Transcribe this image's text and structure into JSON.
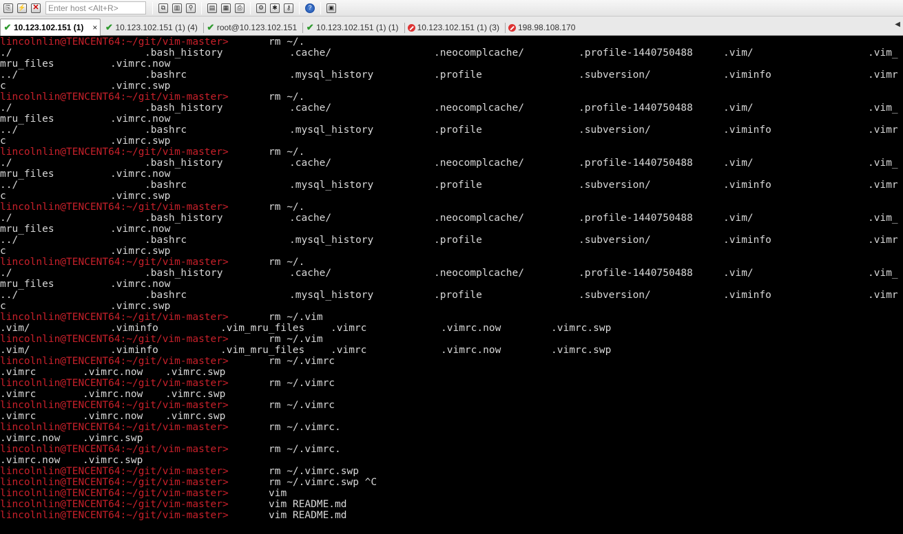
{
  "toolbar": {
    "host_placeholder": "Enter host <Alt+R>",
    "buttons": [
      {
        "name": "connect-icon",
        "glyph": "⎘"
      },
      {
        "name": "quick-connect-icon",
        "glyph": "⚡"
      },
      {
        "name": "disconnect-icon",
        "glyph": "✕"
      },
      {
        "name": "copy-icon",
        "glyph": "⧉"
      },
      {
        "name": "paste-icon",
        "glyph": "📋"
      },
      {
        "name": "find-icon",
        "glyph": "🔍"
      },
      {
        "name": "print-setup-icon",
        "glyph": "▤"
      },
      {
        "name": "print-icon",
        "glyph": "▦"
      },
      {
        "name": "printer-icon",
        "glyph": "⎙"
      },
      {
        "name": "session-options-icon",
        "glyph": "⚙"
      },
      {
        "name": "global-options-icon",
        "glyph": "✱"
      },
      {
        "name": "key-icon",
        "glyph": "⚷"
      },
      {
        "name": "help-icon",
        "glyph": "?"
      },
      {
        "name": "keymap-icon",
        "glyph": "▣"
      }
    ]
  },
  "tabs": [
    {
      "label": "10.123.102.151 (1)",
      "status": "connected",
      "active": true
    },
    {
      "label": "10.123.102.151 (1) (4)",
      "status": "connected",
      "active": false
    },
    {
      "label": "root@10.123.102.151",
      "status": "connected",
      "active": false
    },
    {
      "label": "10.123.102.151 (1) (1)",
      "status": "connected",
      "active": false
    },
    {
      "label": "10.123.102.151 (1) (3)",
      "status": "disconnected",
      "active": false
    },
    {
      "label": "198.98.108.170",
      "status": "disconnected",
      "active": false
    }
  ],
  "tab_close_glyph": "×",
  "tab_scroll_glyph": "◀",
  "terminal": {
    "prompt": "lincolnlin@TENCENT64:~/git/vim-master>",
    "lines": [
      {
        "type": "prompt",
        "cmd": "rm ~/."
      },
      {
        "type": "out",
        "cells": [
          [
            0,
            "./"
          ],
          [
            210,
            ".bash_history"
          ],
          [
            420,
            ".cache/"
          ],
          [
            630,
            ".neocomplcache/"
          ],
          [
            840,
            ".profile-1440750488"
          ],
          [
            1050,
            ".vim/"
          ],
          [
            1260,
            ".vim_"
          ]
        ]
      },
      {
        "type": "out",
        "cells": [
          [
            0,
            "mru_files"
          ],
          [
            160,
            ".vimrc.now"
          ]
        ]
      },
      {
        "type": "out",
        "cells": [
          [
            0,
            "../"
          ],
          [
            210,
            ".bashrc"
          ],
          [
            420,
            ".mysql_history"
          ],
          [
            630,
            ".profile"
          ],
          [
            840,
            ".subversion/"
          ],
          [
            1050,
            ".viminfo"
          ],
          [
            1260,
            ".vimr"
          ]
        ]
      },
      {
        "type": "out",
        "cells": [
          [
            0,
            "c"
          ],
          [
            160,
            ".vimrc.swp"
          ]
        ]
      },
      {
        "type": "prompt",
        "cmd": "rm ~/."
      },
      {
        "type": "out",
        "cells": [
          [
            0,
            "./"
          ],
          [
            210,
            ".bash_history"
          ],
          [
            420,
            ".cache/"
          ],
          [
            630,
            ".neocomplcache/"
          ],
          [
            840,
            ".profile-1440750488"
          ],
          [
            1050,
            ".vim/"
          ],
          [
            1260,
            ".vim_"
          ]
        ]
      },
      {
        "type": "out",
        "cells": [
          [
            0,
            "mru_files"
          ],
          [
            160,
            ".vimrc.now"
          ]
        ]
      },
      {
        "type": "out",
        "cells": [
          [
            0,
            "../"
          ],
          [
            210,
            ".bashrc"
          ],
          [
            420,
            ".mysql_history"
          ],
          [
            630,
            ".profile"
          ],
          [
            840,
            ".subversion/"
          ],
          [
            1050,
            ".viminfo"
          ],
          [
            1260,
            ".vimr"
          ]
        ]
      },
      {
        "type": "out",
        "cells": [
          [
            0,
            "c"
          ],
          [
            160,
            ".vimrc.swp"
          ]
        ]
      },
      {
        "type": "prompt",
        "cmd": "rm ~/."
      },
      {
        "type": "out",
        "cells": [
          [
            0,
            "./"
          ],
          [
            210,
            ".bash_history"
          ],
          [
            420,
            ".cache/"
          ],
          [
            630,
            ".neocomplcache/"
          ],
          [
            840,
            ".profile-1440750488"
          ],
          [
            1050,
            ".vim/"
          ],
          [
            1260,
            ".vim_"
          ]
        ]
      },
      {
        "type": "out",
        "cells": [
          [
            0,
            "mru_files"
          ],
          [
            160,
            ".vimrc.now"
          ]
        ]
      },
      {
        "type": "out",
        "cells": [
          [
            0,
            "../"
          ],
          [
            210,
            ".bashrc"
          ],
          [
            420,
            ".mysql_history"
          ],
          [
            630,
            ".profile"
          ],
          [
            840,
            ".subversion/"
          ],
          [
            1050,
            ".viminfo"
          ],
          [
            1260,
            ".vimr"
          ]
        ]
      },
      {
        "type": "out",
        "cells": [
          [
            0,
            "c"
          ],
          [
            160,
            ".vimrc.swp"
          ]
        ]
      },
      {
        "type": "prompt",
        "cmd": "rm ~/."
      },
      {
        "type": "out",
        "cells": [
          [
            0,
            "./"
          ],
          [
            210,
            ".bash_history"
          ],
          [
            420,
            ".cache/"
          ],
          [
            630,
            ".neocomplcache/"
          ],
          [
            840,
            ".profile-1440750488"
          ],
          [
            1050,
            ".vim/"
          ],
          [
            1260,
            ".vim_"
          ]
        ]
      },
      {
        "type": "out",
        "cells": [
          [
            0,
            "mru_files"
          ],
          [
            160,
            ".vimrc.now"
          ]
        ]
      },
      {
        "type": "out",
        "cells": [
          [
            0,
            "../"
          ],
          [
            210,
            ".bashrc"
          ],
          [
            420,
            ".mysql_history"
          ],
          [
            630,
            ".profile"
          ],
          [
            840,
            ".subversion/"
          ],
          [
            1050,
            ".viminfo"
          ],
          [
            1260,
            ".vimr"
          ]
        ]
      },
      {
        "type": "out",
        "cells": [
          [
            0,
            "c"
          ],
          [
            160,
            ".vimrc.swp"
          ]
        ]
      },
      {
        "type": "prompt",
        "cmd": "rm ~/."
      },
      {
        "type": "out",
        "cells": [
          [
            0,
            "./"
          ],
          [
            210,
            ".bash_history"
          ],
          [
            420,
            ".cache/"
          ],
          [
            630,
            ".neocomplcache/"
          ],
          [
            840,
            ".profile-1440750488"
          ],
          [
            1050,
            ".vim/"
          ],
          [
            1260,
            ".vim_"
          ]
        ]
      },
      {
        "type": "out",
        "cells": [
          [
            0,
            "mru_files"
          ],
          [
            160,
            ".vimrc.now"
          ]
        ]
      },
      {
        "type": "out",
        "cells": [
          [
            0,
            "../"
          ],
          [
            210,
            ".bashrc"
          ],
          [
            420,
            ".mysql_history"
          ],
          [
            630,
            ".profile"
          ],
          [
            840,
            ".subversion/"
          ],
          [
            1050,
            ".viminfo"
          ],
          [
            1260,
            ".vimr"
          ]
        ]
      },
      {
        "type": "out",
        "cells": [
          [
            0,
            "c"
          ],
          [
            160,
            ".vimrc.swp"
          ]
        ]
      },
      {
        "type": "prompt",
        "cmd": "rm ~/.vim"
      },
      {
        "type": "out",
        "cells": [
          [
            0,
            ".vim/"
          ],
          [
            160,
            ".viminfo"
          ],
          [
            320,
            ".vim_mru_files"
          ],
          [
            480,
            ".vimrc"
          ],
          [
            640,
            ".vimrc.now"
          ],
          [
            800,
            ".vimrc.swp"
          ]
        ]
      },
      {
        "type": "prompt",
        "cmd": "rm ~/.vim"
      },
      {
        "type": "out",
        "cells": [
          [
            0,
            ".vim/"
          ],
          [
            160,
            ".viminfo"
          ],
          [
            320,
            ".vim_mru_files"
          ],
          [
            480,
            ".vimrc"
          ],
          [
            640,
            ".vimrc.now"
          ],
          [
            800,
            ".vimrc.swp"
          ]
        ]
      },
      {
        "type": "prompt",
        "cmd": "rm ~/.vimrc"
      },
      {
        "type": "out",
        "cells": [
          [
            0,
            ".vimrc"
          ],
          [
            120,
            ".vimrc.now"
          ],
          [
            240,
            ".vimrc.swp"
          ]
        ]
      },
      {
        "type": "prompt",
        "cmd": "rm ~/.vimrc"
      },
      {
        "type": "out",
        "cells": [
          [
            0,
            ".vimrc"
          ],
          [
            120,
            ".vimrc.now"
          ],
          [
            240,
            ".vimrc.swp"
          ]
        ]
      },
      {
        "type": "prompt",
        "cmd": "rm ~/.vimrc"
      },
      {
        "type": "out",
        "cells": [
          [
            0,
            ".vimrc"
          ],
          [
            120,
            ".vimrc.now"
          ],
          [
            240,
            ".vimrc.swp"
          ]
        ]
      },
      {
        "type": "prompt",
        "cmd": "rm ~/.vimrc."
      },
      {
        "type": "out",
        "cells": [
          [
            0,
            ".vimrc.now"
          ],
          [
            120,
            ".vimrc.swp"
          ]
        ]
      },
      {
        "type": "prompt",
        "cmd": "rm ~/.vimrc."
      },
      {
        "type": "out",
        "cells": [
          [
            0,
            ".vimrc.now"
          ],
          [
            120,
            ".vimrc.swp"
          ]
        ]
      },
      {
        "type": "prompt",
        "cmd": "rm ~/.vimrc.swp"
      },
      {
        "type": "prompt",
        "cmd": "rm ~/.vimrc.swp ^C"
      },
      {
        "type": "prompt",
        "cmd": "vim"
      },
      {
        "type": "prompt",
        "cmd": "vim README.md"
      },
      {
        "type": "prompt",
        "cmd": "vim README.md"
      }
    ]
  }
}
